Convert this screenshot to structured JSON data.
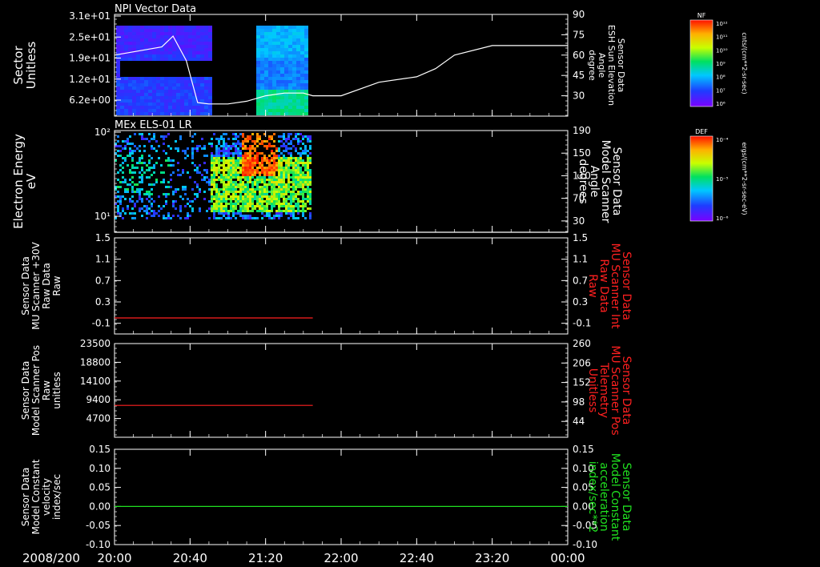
{
  "date_label": "2008/200",
  "time_ticks": [
    "20:00",
    "20:40",
    "21:20",
    "22:00",
    "22:40",
    "23:20",
    "00:00"
  ],
  "colorbars": [
    {
      "id": "nf",
      "title": "NF",
      "unit": "cnts/(cm**2-sr-sec)",
      "ticks": [
        "10¹²",
        "10¹¹",
        "10¹⁰",
        "10⁹",
        "10⁸",
        "10⁷",
        "10⁶"
      ]
    },
    {
      "id": "def",
      "title": "DEF",
      "unit": "ergs/(cm**2-sr-sec-eV)",
      "ticks": [
        "10⁻⁴",
        "10⁻⁵",
        "10⁻⁶"
      ]
    }
  ],
  "chart_data": [
    {
      "type": "heatmap",
      "title": "NPI Vector Data",
      "ylabel": "Sector\nUnitless",
      "yticks": [
        "3.1e+01",
        "2.5e+01",
        "1.9e+01",
        "1.2e+01",
        "6.2e+00"
      ],
      "y2label": "Sensor Data\nESH Sun Elevation\nAngle\ndegree",
      "y2ticks": [
        "90",
        "75",
        "60",
        "45",
        "30"
      ],
      "ylim2": [
        15,
        90
      ],
      "line_series": {
        "color": "#ffffff",
        "x": [
          "20:00",
          "20:25",
          "20:31",
          "20:38",
          "20:44",
          "20:50",
          "21:00",
          "21:10",
          "21:20",
          "21:30",
          "21:40",
          "21:45",
          "22:00",
          "22:20",
          "22:40",
          "22:50",
          "23:00",
          "23:20",
          "23:40",
          "00:00"
        ],
        "y": [
          60,
          66,
          74,
          56,
          25,
          24,
          24,
          26,
          30,
          32,
          32,
          30,
          30,
          40,
          44,
          50,
          60,
          67,
          67,
          67
        ]
      }
    },
    {
      "type": "heatmap",
      "title": "MEx ELS-01 LR",
      "ylabel": "Electron Energy\neV",
      "yticks": [
        "10²",
        "10¹"
      ],
      "y2label": "Sensor Data\nModel Scanner\nAngle\ndegrees",
      "y2ticks": [
        "190",
        "150",
        "110",
        "70",
        "30"
      ],
      "ylim2": [
        10,
        190
      ],
      "line_series": {
        "color": "#ffffff",
        "x": [
          "20:00",
          "00:00"
        ],
        "y": [
          10,
          10
        ]
      }
    },
    {
      "type": "line",
      "ylabel": "Sensor Data\nMU Scanner +30V\nRaw Data\nRaw",
      "yticks": [
        "1.5",
        "1.1",
        "0.7",
        "0.3",
        "-0.1"
      ],
      "ylim": [
        -0.3,
        1.5
      ],
      "y2label": "Sensor Data\nMU Scanner Int\nRaw Data\nRaw",
      "y2ticks": [
        "1.5",
        "1.1",
        "0.7",
        "0.3",
        "-0.1"
      ],
      "ylim2": [
        -0.3,
        1.5
      ],
      "series": [
        {
          "color": "#ff2020",
          "x": [
            "20:00",
            "21:45"
          ],
          "y": [
            0.0,
            0.0
          ]
        }
      ]
    },
    {
      "type": "line",
      "ylabel": "Sensor Data\nModel Scanner Pos\nRaw\nunitless",
      "yticks": [
        "23500",
        "18800",
        "14100",
        "9400",
        "4700"
      ],
      "ylim": [
        0,
        23500
      ],
      "y2label": "Sensor Data\nMU Scanner Pos\nTelemetry\nUnitless",
      "y2ticks": [
        "260",
        "206",
        "152",
        "98",
        "44"
      ],
      "ylim2": [
        0,
        260
      ],
      "series": [
        {
          "color": "#ff2020",
          "x": [
            "20:00",
            "21:45"
          ],
          "y": [
            8000,
            8000
          ]
        }
      ]
    },
    {
      "type": "line",
      "ylabel": "Sensor Data\nModel Constant\nvelocity\nindex/sec",
      "yticks": [
        "0.15",
        "0.10",
        "0.05",
        "0.00",
        "-0.05",
        "-0.10"
      ],
      "ylim": [
        -0.1,
        0.15
      ],
      "y2label": "Sensor Data\nModel Constant\nacceleration\nindex/sec**2",
      "y2ticks": [
        "0.15",
        "0.10",
        "0.05",
        "0.00",
        "-0.05",
        "-0.10"
      ],
      "ylim2": [
        -0.1,
        0.15
      ],
      "series": [
        {
          "color": "#20e020",
          "x": [
            "20:00",
            "00:00"
          ],
          "y": [
            0.0,
            0.0
          ]
        }
      ]
    }
  ]
}
